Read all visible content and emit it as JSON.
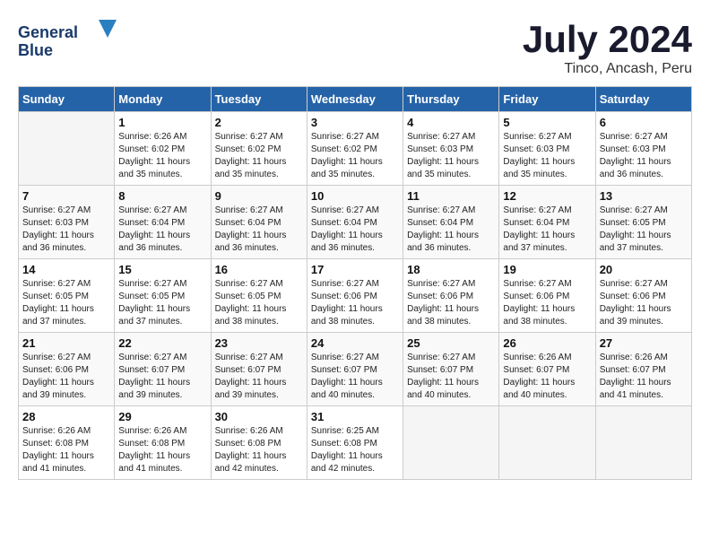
{
  "header": {
    "logo_line1": "General",
    "logo_line2": "Blue",
    "main_title": "July 2024",
    "subtitle": "Tinco, Ancash, Peru"
  },
  "days_of_week": [
    "Sunday",
    "Monday",
    "Tuesday",
    "Wednesday",
    "Thursday",
    "Friday",
    "Saturday"
  ],
  "weeks": [
    [
      {
        "day": "",
        "info": ""
      },
      {
        "day": "1",
        "info": "Sunrise: 6:26 AM\nSunset: 6:02 PM\nDaylight: 11 hours\nand 35 minutes."
      },
      {
        "day": "2",
        "info": "Sunrise: 6:27 AM\nSunset: 6:02 PM\nDaylight: 11 hours\nand 35 minutes."
      },
      {
        "day": "3",
        "info": "Sunrise: 6:27 AM\nSunset: 6:02 PM\nDaylight: 11 hours\nand 35 minutes."
      },
      {
        "day": "4",
        "info": "Sunrise: 6:27 AM\nSunset: 6:03 PM\nDaylight: 11 hours\nand 35 minutes."
      },
      {
        "day": "5",
        "info": "Sunrise: 6:27 AM\nSunset: 6:03 PM\nDaylight: 11 hours\nand 35 minutes."
      },
      {
        "day": "6",
        "info": "Sunrise: 6:27 AM\nSunset: 6:03 PM\nDaylight: 11 hours\nand 36 minutes."
      }
    ],
    [
      {
        "day": "7",
        "info": "Sunrise: 6:27 AM\nSunset: 6:03 PM\nDaylight: 11 hours\nand 36 minutes."
      },
      {
        "day": "8",
        "info": "Sunrise: 6:27 AM\nSunset: 6:04 PM\nDaylight: 11 hours\nand 36 minutes."
      },
      {
        "day": "9",
        "info": "Sunrise: 6:27 AM\nSunset: 6:04 PM\nDaylight: 11 hours\nand 36 minutes."
      },
      {
        "day": "10",
        "info": "Sunrise: 6:27 AM\nSunset: 6:04 PM\nDaylight: 11 hours\nand 36 minutes."
      },
      {
        "day": "11",
        "info": "Sunrise: 6:27 AM\nSunset: 6:04 PM\nDaylight: 11 hours\nand 36 minutes."
      },
      {
        "day": "12",
        "info": "Sunrise: 6:27 AM\nSunset: 6:04 PM\nDaylight: 11 hours\nand 37 minutes."
      },
      {
        "day": "13",
        "info": "Sunrise: 6:27 AM\nSunset: 6:05 PM\nDaylight: 11 hours\nand 37 minutes."
      }
    ],
    [
      {
        "day": "14",
        "info": "Sunrise: 6:27 AM\nSunset: 6:05 PM\nDaylight: 11 hours\nand 37 minutes."
      },
      {
        "day": "15",
        "info": "Sunrise: 6:27 AM\nSunset: 6:05 PM\nDaylight: 11 hours\nand 37 minutes."
      },
      {
        "day": "16",
        "info": "Sunrise: 6:27 AM\nSunset: 6:05 PM\nDaylight: 11 hours\nand 38 minutes."
      },
      {
        "day": "17",
        "info": "Sunrise: 6:27 AM\nSunset: 6:06 PM\nDaylight: 11 hours\nand 38 minutes."
      },
      {
        "day": "18",
        "info": "Sunrise: 6:27 AM\nSunset: 6:06 PM\nDaylight: 11 hours\nand 38 minutes."
      },
      {
        "day": "19",
        "info": "Sunrise: 6:27 AM\nSunset: 6:06 PM\nDaylight: 11 hours\nand 38 minutes."
      },
      {
        "day": "20",
        "info": "Sunrise: 6:27 AM\nSunset: 6:06 PM\nDaylight: 11 hours\nand 39 minutes."
      }
    ],
    [
      {
        "day": "21",
        "info": "Sunrise: 6:27 AM\nSunset: 6:06 PM\nDaylight: 11 hours\nand 39 minutes."
      },
      {
        "day": "22",
        "info": "Sunrise: 6:27 AM\nSunset: 6:07 PM\nDaylight: 11 hours\nand 39 minutes."
      },
      {
        "day": "23",
        "info": "Sunrise: 6:27 AM\nSunset: 6:07 PM\nDaylight: 11 hours\nand 39 minutes."
      },
      {
        "day": "24",
        "info": "Sunrise: 6:27 AM\nSunset: 6:07 PM\nDaylight: 11 hours\nand 40 minutes."
      },
      {
        "day": "25",
        "info": "Sunrise: 6:27 AM\nSunset: 6:07 PM\nDaylight: 11 hours\nand 40 minutes."
      },
      {
        "day": "26",
        "info": "Sunrise: 6:26 AM\nSunset: 6:07 PM\nDaylight: 11 hours\nand 40 minutes."
      },
      {
        "day": "27",
        "info": "Sunrise: 6:26 AM\nSunset: 6:07 PM\nDaylight: 11 hours\nand 41 minutes."
      }
    ],
    [
      {
        "day": "28",
        "info": "Sunrise: 6:26 AM\nSunset: 6:08 PM\nDaylight: 11 hours\nand 41 minutes."
      },
      {
        "day": "29",
        "info": "Sunrise: 6:26 AM\nSunset: 6:08 PM\nDaylight: 11 hours\nand 41 minutes."
      },
      {
        "day": "30",
        "info": "Sunrise: 6:26 AM\nSunset: 6:08 PM\nDaylight: 11 hours\nand 42 minutes."
      },
      {
        "day": "31",
        "info": "Sunrise: 6:25 AM\nSunset: 6:08 PM\nDaylight: 11 hours\nand 42 minutes."
      },
      {
        "day": "",
        "info": ""
      },
      {
        "day": "",
        "info": ""
      },
      {
        "day": "",
        "info": ""
      }
    ]
  ]
}
